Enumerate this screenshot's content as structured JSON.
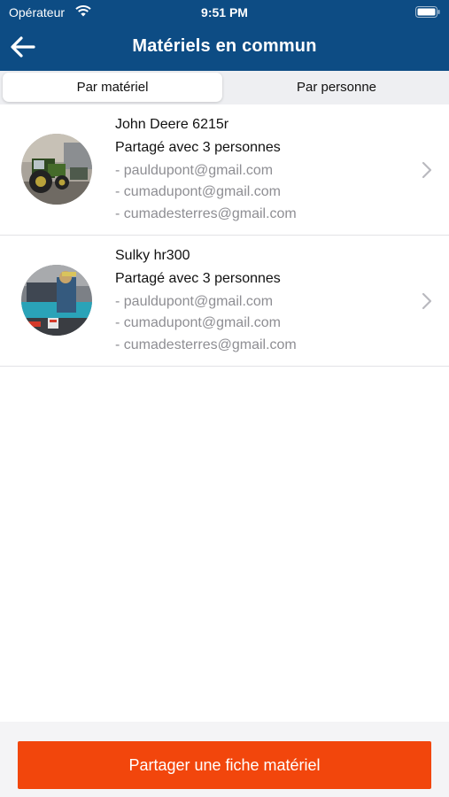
{
  "status_bar": {
    "carrier": "Opérateur",
    "time": "9:51 PM"
  },
  "header": {
    "title": "Matériels en commun"
  },
  "tabs": [
    {
      "label": "Par matériel",
      "selected": true
    },
    {
      "label": "Par personne",
      "selected": false
    }
  ],
  "items": [
    {
      "name": "John Deere 6215r",
      "shared_label": "Partagé avec 3 personnes",
      "emails": [
        "- pauldupont@gmail.com",
        "- cumadupont@gmail.com",
        "- cumadesterres@gmail.com"
      ]
    },
    {
      "name": "Sulky hr300",
      "shared_label": "Partagé avec 3 personnes",
      "emails": [
        "- pauldupont@gmail.com",
        "- cumadupont@gmail.com",
        "- cumadesterres@gmail.com"
      ]
    }
  ],
  "footer": {
    "button_label": "Partager une fiche matériel"
  },
  "colors": {
    "nav": "#0d4c84",
    "accent": "#f2460c",
    "secondary_text": "#8e8e93"
  }
}
